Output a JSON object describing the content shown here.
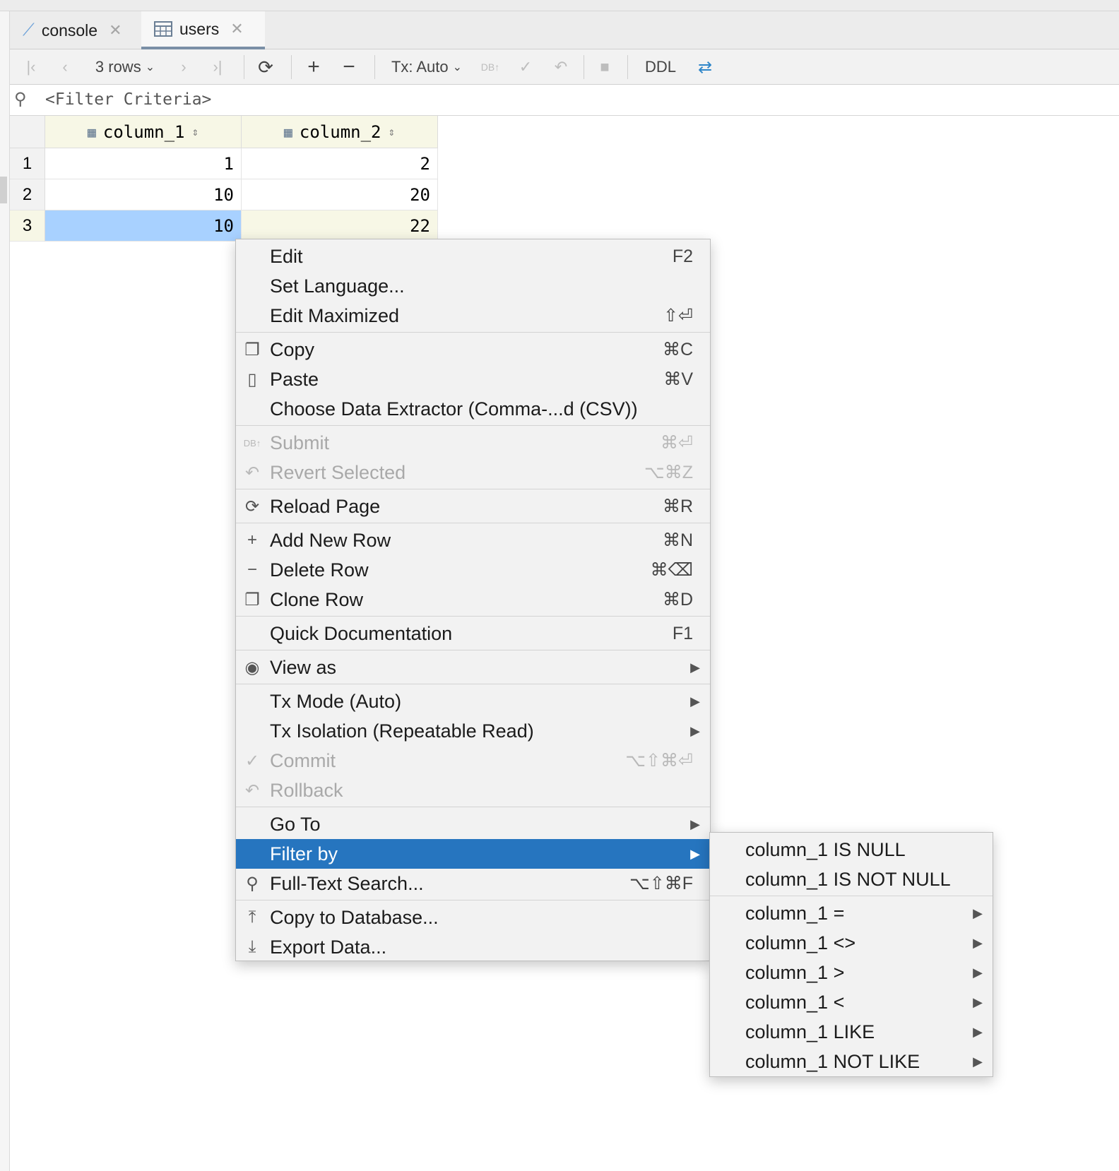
{
  "tabs": [
    {
      "label": "console",
      "icon": "console-icon",
      "active": false
    },
    {
      "label": "users",
      "icon": "table-icon",
      "active": true
    }
  ],
  "toolbar": {
    "rows_label": "3 rows",
    "tx_label": "Tx: Auto",
    "ddl_label": "DDL"
  },
  "filter": {
    "placeholder": "<Filter Criteria>"
  },
  "grid": {
    "columns": [
      "column_1",
      "column_2"
    ],
    "rows": [
      {
        "num": "1",
        "cells": [
          "1",
          "2"
        ]
      },
      {
        "num": "2",
        "cells": [
          "10",
          "20"
        ]
      },
      {
        "num": "3",
        "cells": [
          "10",
          "22"
        ]
      }
    ],
    "selected_row": 3
  },
  "context_menu": {
    "items": [
      {
        "label": "Edit",
        "shortcut": "F2"
      },
      {
        "label": "Set Language...",
        "shortcut": ""
      },
      {
        "label": "Edit Maximized",
        "shortcut": "⇧⏎"
      },
      {
        "label": "Copy",
        "shortcut": "⌘C",
        "icon": "copy-icon"
      },
      {
        "label": "Paste",
        "shortcut": "⌘V",
        "icon": "paste-icon"
      },
      {
        "label": "Choose Data Extractor (Comma-...d (CSV))",
        "shortcut": ""
      },
      {
        "label": "Submit",
        "shortcut": "⌘⏎",
        "icon": "submit-icon",
        "disabled": true
      },
      {
        "label": "Revert Selected",
        "shortcut": "⌥⌘Z",
        "icon": "revert-icon",
        "disabled": true
      },
      {
        "label": "Reload Page",
        "shortcut": "⌘R",
        "icon": "reload-icon"
      },
      {
        "label": "Add New Row",
        "shortcut": "⌘N",
        "icon": "plus-icon"
      },
      {
        "label": "Delete Row",
        "shortcut": "⌘⌫",
        "icon": "minus-icon"
      },
      {
        "label": "Clone Row",
        "shortcut": "⌘D",
        "icon": "clone-icon"
      },
      {
        "label": "Quick Documentation",
        "shortcut": "F1"
      },
      {
        "label": "View as",
        "submenu": true,
        "icon": "eye-icon"
      },
      {
        "label": "Tx Mode (Auto)",
        "submenu": true
      },
      {
        "label": "Tx Isolation (Repeatable Read)",
        "submenu": true
      },
      {
        "label": "Commit",
        "shortcut": "⌥⇧⌘⏎",
        "icon": "check-icon",
        "disabled": true
      },
      {
        "label": "Rollback",
        "shortcut": "",
        "icon": "rollback-icon",
        "disabled": true
      },
      {
        "label": "Go To",
        "submenu": true
      },
      {
        "label": "Filter by",
        "submenu": true,
        "highlighted": true
      },
      {
        "label": "Full-Text Search...",
        "shortcut": "⌥⇧⌘F",
        "icon": "search-icon"
      },
      {
        "label": "Copy to Database...",
        "shortcut": "",
        "icon": "upload-icon"
      },
      {
        "label": "Export Data...",
        "shortcut": "",
        "icon": "download-icon"
      }
    ]
  },
  "filter_submenu": {
    "items": [
      {
        "label": "column_1 IS NULL"
      },
      {
        "label": "column_1 IS NOT NULL"
      },
      {
        "label": "column_1 =",
        "submenu": true
      },
      {
        "label": "column_1 <>",
        "submenu": true
      },
      {
        "label": "column_1 >",
        "submenu": true
      },
      {
        "label": "column_1 <",
        "submenu": true
      },
      {
        "label": "column_1 LIKE",
        "submenu": true
      },
      {
        "label": "column_1 NOT LIKE",
        "submenu": true
      }
    ]
  },
  "colors": {
    "highlight": "#2675bf",
    "selected_cell": "#a8d1ff",
    "header_bg": "#f7f7e6"
  }
}
